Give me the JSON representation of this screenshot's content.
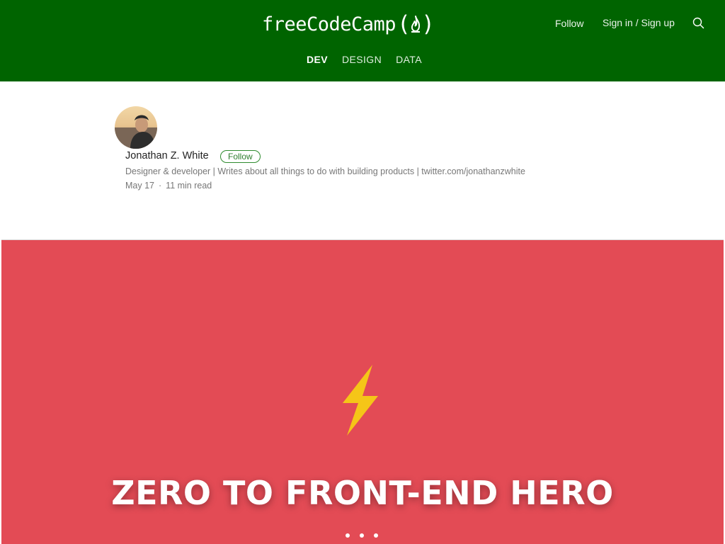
{
  "header": {
    "logo_text": "freeCodeCamp",
    "logo_icon": "flame-icon",
    "follow_label": "Follow",
    "signin_label": "Sign in / Sign up",
    "search_icon": "search-icon",
    "background_color": "#006400",
    "tabs": [
      {
        "label": "DEV",
        "active": true
      },
      {
        "label": "DESIGN",
        "active": false
      },
      {
        "label": "DATA",
        "active": false
      }
    ]
  },
  "author": {
    "name": "Jonathan Z. White",
    "follow_label": "Follow",
    "bio": "Designer & developer | Writes about all things to do with building products | twitter.com/jonathanzwhite",
    "date": "May 17",
    "separator": "·",
    "read_time": "11 min read"
  },
  "hero": {
    "title": "ZERO TO FRONT-END HERO",
    "icon": "lightning-bolt-icon",
    "background_color": "#e34b55",
    "icon_color": "#f5c518"
  }
}
